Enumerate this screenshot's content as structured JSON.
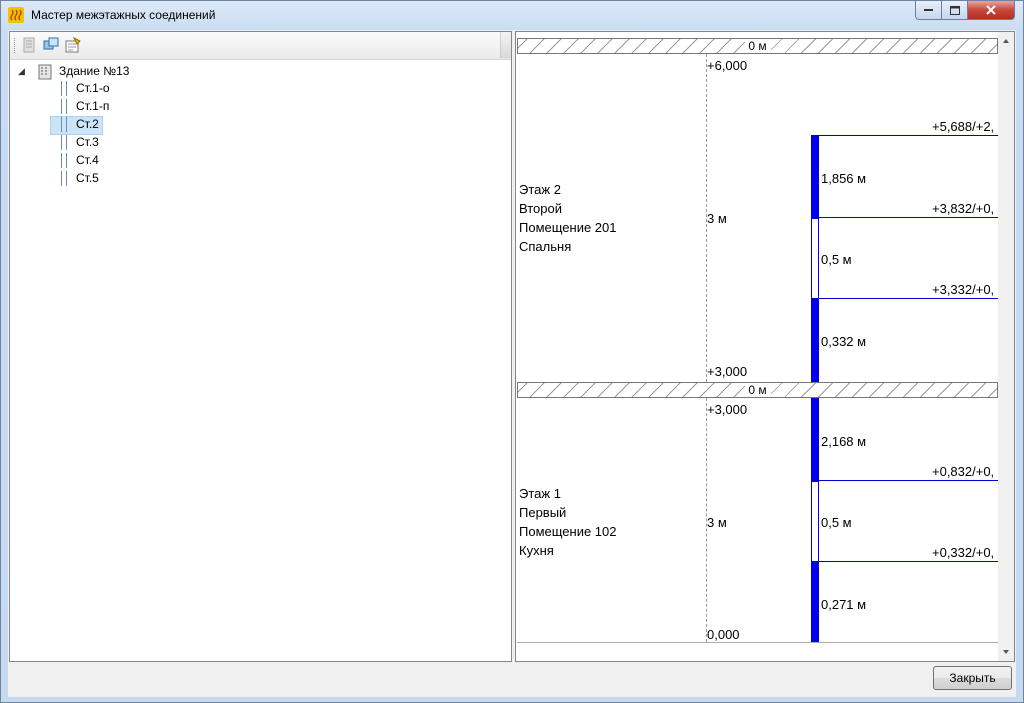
{
  "window": {
    "title": "Мастер межэтажных соединений"
  },
  "tree": {
    "root": "Здание №13",
    "items": [
      "Ст.1-о",
      "Ст.1-п",
      "Ст.2",
      "Ст.3",
      "Ст.4",
      "Ст.5"
    ],
    "selected": "Ст.2"
  },
  "diagram": {
    "floor_marker": "0 м",
    "floor2": {
      "lines": [
        "Этаж 2",
        "Второй",
        "Помещение 201",
        "Спальня"
      ],
      "top_level": "+6,000",
      "height": "3 м",
      "bottom_level": "+3,000"
    },
    "floor1": {
      "lines": [
        "Этаж 1",
        "Первый",
        "Помещение 102",
        "Кухня"
      ],
      "top_level": "+3,000",
      "height": "3 м",
      "bottom_level": "0,000"
    },
    "segments": [
      {
        "label": "1,856 м",
        "type": "filled"
      },
      {
        "label": "0,5 м",
        "type": "open"
      },
      {
        "label": "0,332 м",
        "type": "filled"
      },
      {
        "label": "2,168 м",
        "type": "filled"
      },
      {
        "label": "0,5 м",
        "type": "open"
      },
      {
        "label": "0,271 м",
        "type": "filled"
      }
    ],
    "marks": [
      "+5,688/+2,",
      "+3,832/+0,",
      "+3,332/+0,",
      "+0,832/+0,",
      "+0,332/+0,"
    ]
  },
  "footer": {
    "close_label": "Закрыть"
  }
}
